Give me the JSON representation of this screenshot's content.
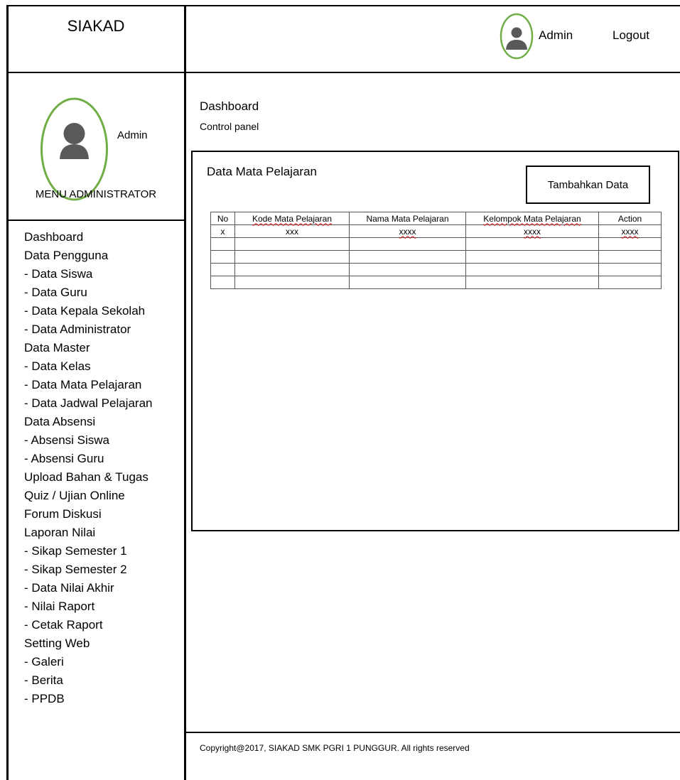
{
  "app": {
    "brand": "SIAKAD"
  },
  "header": {
    "user_name": "Admin",
    "logout_label": "Logout"
  },
  "sidebar": {
    "user_name": "Admin",
    "title": "MENU ADMINISTRATOR",
    "items": [
      {
        "label": "Dashboard"
      },
      {
        "label": "Data Pengguna"
      },
      {
        "label": "- Data Siswa"
      },
      {
        "label": "- Data Guru"
      },
      {
        "label": "- Data Kepala Sekolah"
      },
      {
        "label": "- Data Administrator"
      },
      {
        "label": "Data Master"
      },
      {
        "label": "- Data Kelas"
      },
      {
        "label": "- Data Mata Pelajaran"
      },
      {
        "label": "- Data Jadwal Pelajaran"
      },
      {
        "label": "Data Absensi"
      },
      {
        "label": "- Absensi Siswa"
      },
      {
        "label": "- Absensi Guru"
      },
      {
        "label": "Upload Bahan & Tugas"
      },
      {
        "label": "Quiz / Ujian Online"
      },
      {
        "label": "Forum Diskusi"
      },
      {
        "label": "Laporan Nilai"
      },
      {
        "label": "- Sikap Semester 1"
      },
      {
        "label": "- Sikap Semester 2"
      },
      {
        "label": "- Data Nilai Akhir"
      },
      {
        "label": "- Nilai Raport"
      },
      {
        "label": "- Cetak Raport"
      },
      {
        "label": "Setting Web"
      },
      {
        "label": "- Galeri"
      },
      {
        "label": "- Berita"
      },
      {
        "label": "- PPDB"
      }
    ]
  },
  "main": {
    "title": "Dashboard",
    "subtitle": "Control panel",
    "panel": {
      "title": "Data Mata Pelajaran",
      "add_button_label": "Tambahkan Data",
      "table": {
        "headers": [
          "No",
          "Kode Mata Pelajaran",
          "Nama Mata Pelajaran",
          "Kelompok Mata Pelajaran",
          "Action"
        ],
        "rows": [
          [
            "x",
            "xxx",
            "xxxx",
            "xxxx",
            "xxxx"
          ],
          [
            "",
            "",
            "",
            "",
            ""
          ],
          [
            "",
            "",
            "",
            "",
            ""
          ],
          [
            "",
            "",
            "",
            "",
            ""
          ],
          [
            "",
            "",
            "",
            "",
            ""
          ]
        ]
      }
    }
  },
  "footer": {
    "text": "Copyright@2017, SIAKAD SMK PGRI 1 PUNGGUR. All rights reserved"
  },
  "colors": {
    "avatar_ring": "#70ad47",
    "avatar_fill": "#595959",
    "spell_underline": "#dd1111"
  },
  "icons": {
    "avatar": "user-avatar-icon"
  }
}
